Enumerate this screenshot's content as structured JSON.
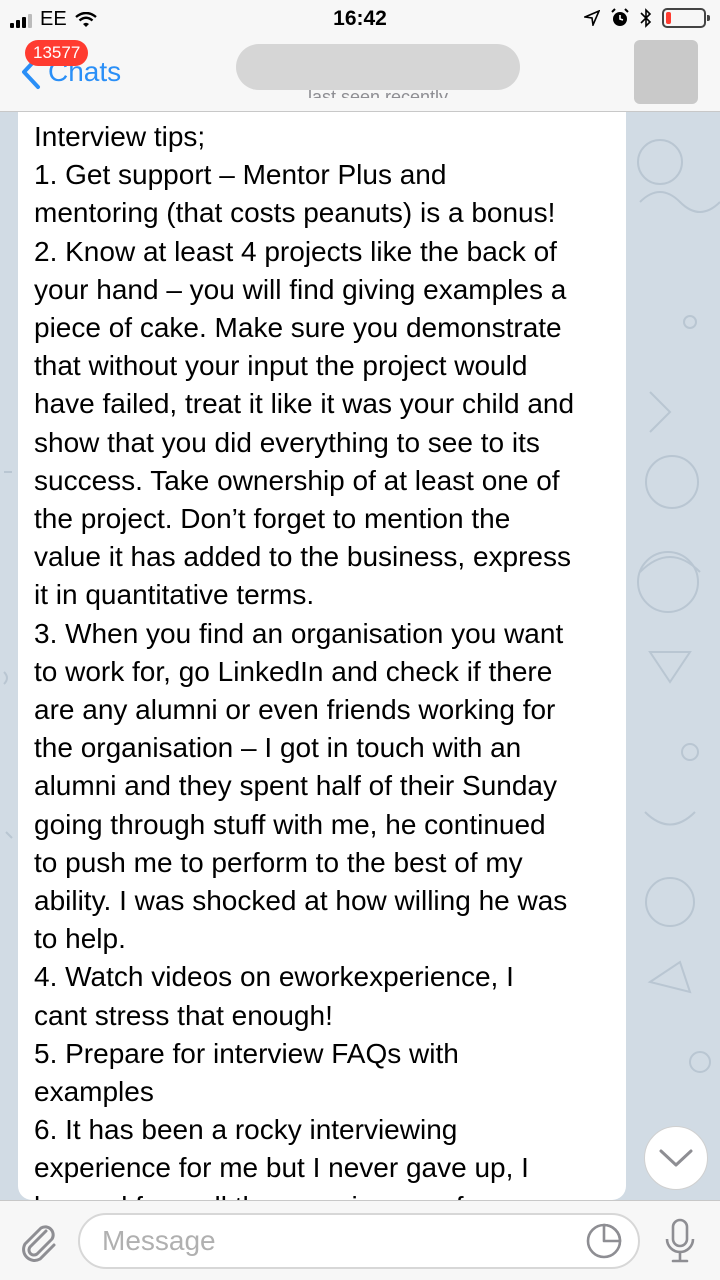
{
  "status_bar": {
    "carrier": "EE",
    "time": "16:42"
  },
  "nav": {
    "unread_badge": "13577",
    "back_label": "Chats",
    "contact_status": "last seen recently"
  },
  "message": {
    "lines": [
      "Interview tips;",
      "1.  Get support – Mentor Plus and",
      "mentoring (that costs peanuts) is a bonus!",
      "2.  Know at least 4 projects like the back of",
      "your hand – you will find giving examples a",
      "piece of cake. Make sure you demonstrate",
      "that without your input the project would",
      "have failed, treat it like it was your child and",
      "show that you did everything to see to its",
      "success. Take ownership of at least one of",
      "the project. Don’t forget to mention the",
      "value it has added to the business, express",
      "it in quantitative terms.",
      "3.   When you find an organisation you want",
      "to work for, go LinkedIn and check if there",
      "are any alumni or even friends working for",
      "the organisation – I got in touch with an",
      "alumni and they spent half of their Sunday",
      "going through stuff with me, he continued",
      "to push me to perform to the best of my",
      "ability. I was shocked at how willing he was",
      "to help.",
      "4.  Watch videos on eworkexperience, I",
      "cant stress that enough!",
      "5.  Prepare for interview FAQs with",
      "examples",
      "6.  It has been a rocky interviewing",
      "experience for me but I never gave up, I",
      "learned from all the experiences of"
    ]
  },
  "input": {
    "placeholder": "Message",
    "value": ""
  },
  "colors": {
    "accent": "#2a8ff7",
    "badge": "#ff3b30",
    "chat_background": "#d1dbe4"
  },
  "icons": [
    "wifi-icon",
    "location-arrow-icon",
    "alarm-icon",
    "bluetooth-icon",
    "battery-icon",
    "chevron-left-icon",
    "chevron-down-icon",
    "paperclip-icon",
    "sticker-icon",
    "microphone-icon"
  ]
}
